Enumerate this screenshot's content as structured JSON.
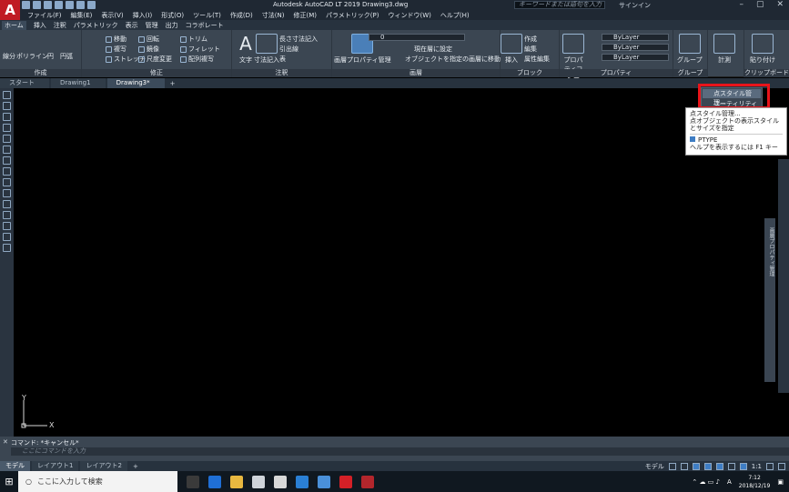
{
  "window": {
    "title": "Autodesk AutoCAD LT 2019   Drawing3.dwg",
    "search_placeholder": "キーワードまたは語句を入力",
    "signin": "サインイン"
  },
  "menu": [
    "ファイル(F)",
    "編集(E)",
    "表示(V)",
    "挿入(I)",
    "形式(O)",
    "ツール(T)",
    "作成(D)",
    "寸法(N)",
    "修正(M)",
    "パラメトリック(P)",
    "ウィンドウ(W)",
    "ヘルプ(H)"
  ],
  "ribbon_tabs": [
    "ホーム",
    "挿入",
    "注釈",
    "パラメトリック",
    "表示",
    "管理",
    "出力",
    "コラボレート"
  ],
  "panels": {
    "draw": {
      "label": "作成",
      "tools": [
        "線分",
        "ポリライン",
        "円",
        "円弧"
      ]
    },
    "modify": {
      "label": "修正",
      "tools": [
        "移動",
        "回転",
        "トリム",
        "複写",
        "鏡像",
        "フィレット",
        "ストレッチ",
        "尺度変更",
        "配列複写"
      ]
    },
    "annotation": {
      "label": "注釈",
      "text": "文字",
      "dim": "寸法記入",
      "tools": [
        "長さ寸法記入",
        "引出線",
        "表"
      ]
    },
    "layers": {
      "label": "画層",
      "big": "画層プロパティ管理",
      "tools": [
        "現在層に設定",
        "オブジェクトを指定の画層に移動"
      ],
      "current": "0"
    },
    "block": {
      "label": "ブロック",
      "insert": "挿入",
      "tools": [
        "作成",
        "編集",
        "属性編集"
      ]
    },
    "properties": {
      "label": "プロパティ",
      "match": "プロパティコピー",
      "values": [
        "ByLayer",
        "ByLayer",
        "ByLayer"
      ]
    },
    "groups": {
      "label": "グループ",
      "big": "グループ"
    },
    "utilities": {
      "label": "ユーティリティ",
      "measure": "計測"
    },
    "clipboard": {
      "label": "クリップボード",
      "paste": "貼り付け"
    }
  },
  "doc_tabs": [
    "スタート",
    "Drawing1",
    "Drawing3*"
  ],
  "dropdown": {
    "header": "ユーティリティ",
    "items": [
      "点スタイル管理...",
      "ユーティリティ"
    ]
  },
  "tooltip": {
    "title": "点スタイル管理...",
    "desc": "点オブジェクトの表示スタイルとサイズを指定",
    "command": "PTYPE",
    "help": "ヘルプを表示するには F1 キー"
  },
  "palette_label": "画層プロパティ管理",
  "ucs": {
    "x": "X",
    "y": "Y"
  },
  "command": {
    "history": "コマンド: *キャンセル*",
    "placeholder": "ここにコマンドを入力"
  },
  "layout_tabs": [
    "モデル",
    "レイアウト1",
    "レイアウト2"
  ],
  "status": {
    "model": "モデル",
    "scale": "1:1"
  },
  "taskbar": {
    "search": "ここに入力して検索",
    "time": "7:12",
    "date": "2018/12/19",
    "ime": "A"
  }
}
